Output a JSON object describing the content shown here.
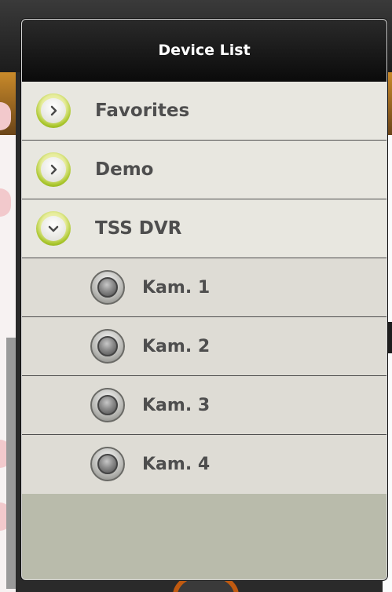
{
  "dialog": {
    "title": "Device List"
  },
  "groups": [
    {
      "label": "Favorites",
      "expanded": false,
      "icon": "chevron-right-icon"
    },
    {
      "label": "Demo",
      "expanded": false,
      "icon": "chevron-right-icon"
    },
    {
      "label": "TSS DVR",
      "expanded": true,
      "icon": "chevron-down-icon",
      "children": [
        {
          "label": "Kam. 1",
          "icon": "camera-icon"
        },
        {
          "label": "Kam. 2",
          "icon": "camera-icon"
        },
        {
          "label": "Kam. 3",
          "icon": "camera-icon"
        },
        {
          "label": "Kam. 4",
          "icon": "camera-icon"
        }
      ]
    }
  ],
  "colors": {
    "header_bg": "#0b0b0b",
    "row_bg": "#e8e7e0",
    "child_bg": "#dedcd5",
    "empty_area": "#b9bbab",
    "accent_green": "#a8c52a",
    "text": "#4e4e4e"
  }
}
